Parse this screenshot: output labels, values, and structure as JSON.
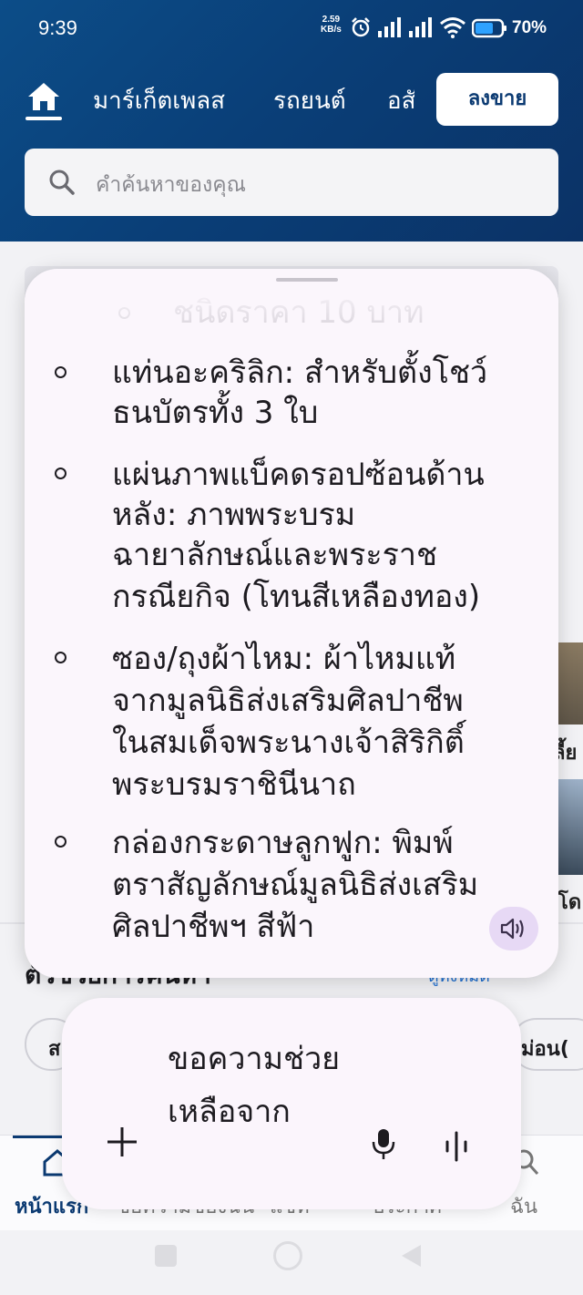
{
  "status_bar": {
    "time": "9:39",
    "speed_value": "2.59",
    "speed_unit": "KB/s",
    "battery": "70%"
  },
  "nav": {
    "tabs": [
      "มาร์เก็ตเพลส",
      "รถยนต์",
      "อสังหาฯ"
    ],
    "sell_button": "ลงขาย"
  },
  "search": {
    "placeholder": "คำค้นหาของคุณ"
  },
  "reading_card": {
    "faded_item": "ชนิดราคา 10 บาท",
    "items": [
      {
        "lines": [
          "แท่นอะคริลิก: สำหรับตั้งโชว์",
          "ธนบัตรทั้ง 3 ใบ"
        ]
      },
      {
        "lines": [
          "แผ่นภาพแบ็คดรอปซ้อนด้าน",
          "หลัง: ภาพพระบรม",
          "ฉายาลักษณ์และพระราช",
          "กรณียกิจ (โทนสีเหลืองทอง)"
        ]
      },
      {
        "lines": [
          "ซอง/ถุงผ้าไหม: ผ้าไหมแท้",
          "จากมูลนิธิส่งเสริมศิลปาชีพ",
          "ในสมเด็จพระนางเจ้าสิริกิติ์",
          "พระบรมราชินีนาถ"
        ]
      },
      {
        "lines": [
          "กล่องกระดาษลูกฟูก: พิมพ์",
          "ตราสัญลักษณ์มูลนิธิส่งเสริม",
          "ศิลปาชีพฯ สีฟ้า"
        ]
      }
    ]
  },
  "background_page": {
    "side_label_1": "ลี้ย",
    "side_label_2": "โด",
    "section_title": "ตัวช่วยการค้นหา",
    "section_link": "ดูทั้งหมด",
    "chip_left": "ส",
    "chip_right": "ม่อน(",
    "bottom_nav": [
      "หน้าแรก",
      "ข้อความของฉัน",
      "แชท",
      "ประกาศ",
      "ฉัน"
    ]
  },
  "input_bar": {
    "prompt": "ขอความช่วยเหลือจาก"
  },
  "colors": {
    "header": "#0b3a72",
    "card": "#fbf6fc",
    "accent_link": "#1f6fd1",
    "speaker_bg": "#e7d9f5"
  }
}
